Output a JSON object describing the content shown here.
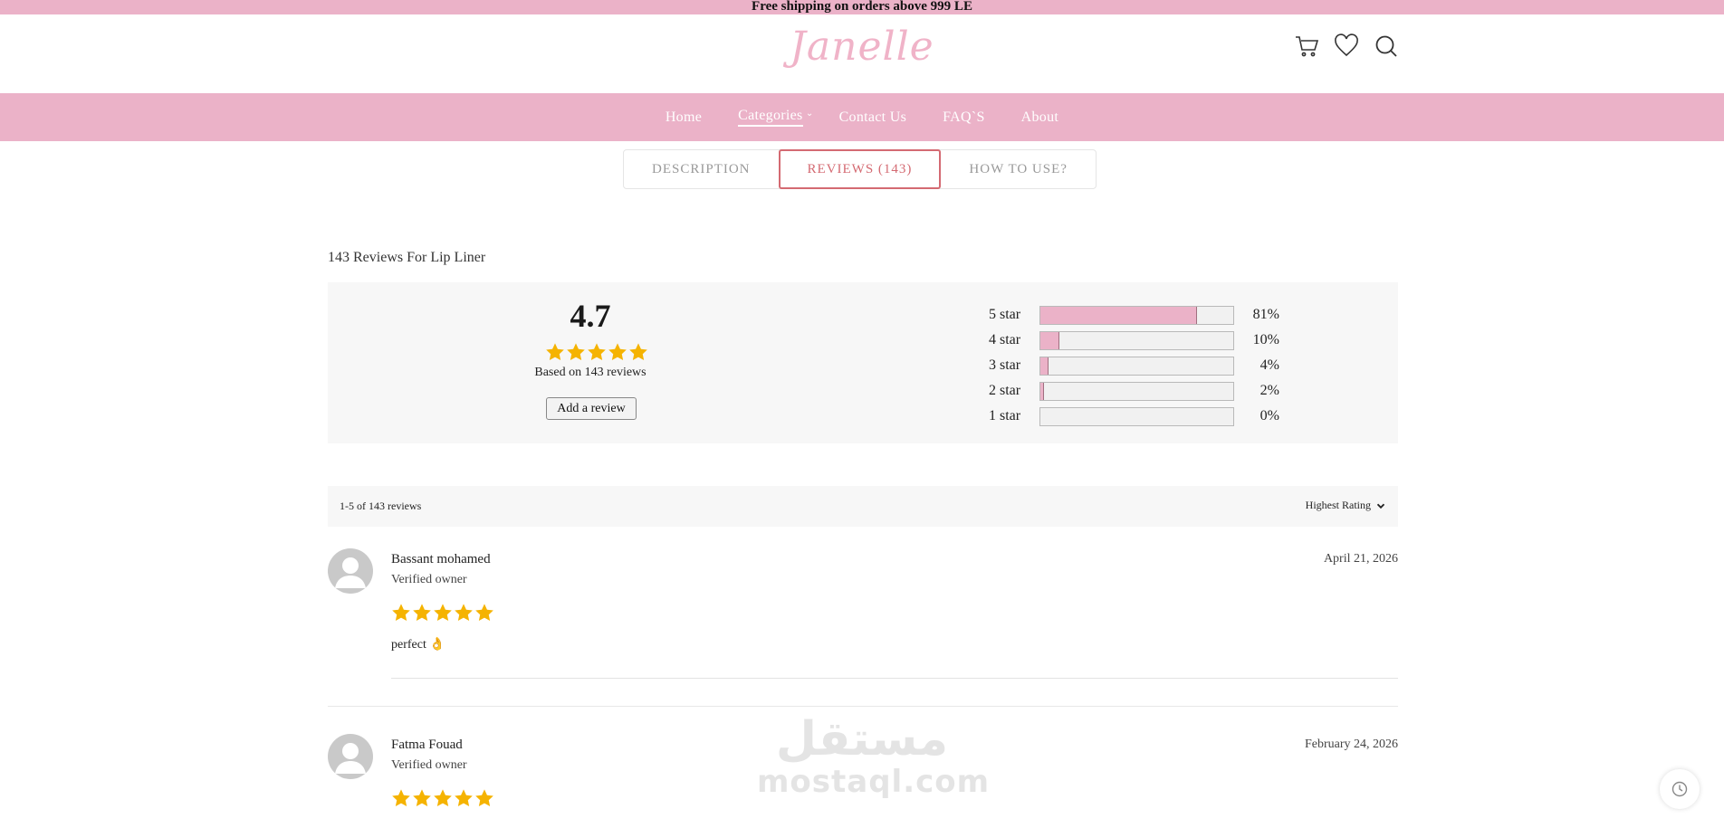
{
  "topbar": {
    "text": "Free shipping on orders above 999 LE"
  },
  "header": {
    "logo_text": "Janelle"
  },
  "nav": {
    "items": [
      "Home",
      "Categories",
      "Contact Us",
      "FAQ`S",
      "About"
    ]
  },
  "tabs": [
    {
      "label": "DESCRIPTION",
      "active": false
    },
    {
      "label": "REVIEWS (143)",
      "active": true
    },
    {
      "label": "HOW TO USE?",
      "active": false
    }
  ],
  "reviews_heading": "143 Reviews For Lip Liner",
  "summary": {
    "average": "4.7",
    "rating": 4.7,
    "based_on": "Based on 143 reviews",
    "add_review": "Add a review",
    "breakdown": [
      {
        "label": "5 star",
        "pct": "81%",
        "value": 81
      },
      {
        "label": "4 star",
        "pct": "10%",
        "value": 10
      },
      {
        "label": "3 star",
        "pct": "4%",
        "value": 4
      },
      {
        "label": "2 star",
        "pct": "2%",
        "value": 2
      },
      {
        "label": "1 star",
        "pct": "0%",
        "value": 0
      }
    ]
  },
  "list": {
    "count": "1-5 of 143 reviews",
    "sort": "Highest Rating"
  },
  "reviews": [
    {
      "name": "Bassant mohamed",
      "verified": "Verified owner",
      "date": "April 21, 2026",
      "rating": 5,
      "text": "perfect 👌"
    },
    {
      "name": "Fatma Fouad",
      "verified": "Verified owner",
      "date": "February 24, 2026",
      "rating": 5,
      "text": ""
    }
  ],
  "watermark": {
    "arabic": "مستقل",
    "latin": "mostaql.com"
  },
  "colors": {
    "brand_pink": "#ebb2c8",
    "accent_red": "#d46a72",
    "star": "#f5b301"
  }
}
